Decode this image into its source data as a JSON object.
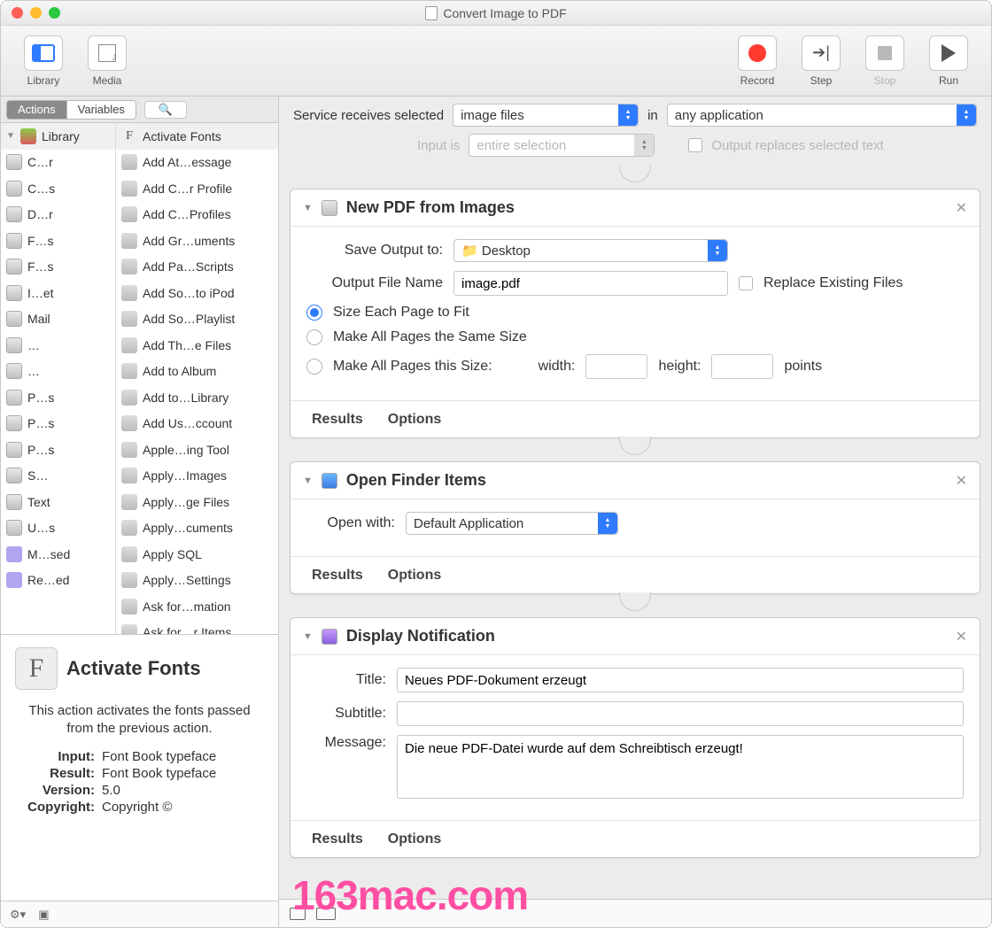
{
  "window": {
    "title": "Convert Image to PDF"
  },
  "toolbar": {
    "library": "Library",
    "media": "Media",
    "record": "Record",
    "step": "Step",
    "stop": "Stop",
    "run": "Run"
  },
  "tabs": {
    "actions": "Actions",
    "variables": "Variables"
  },
  "col1": {
    "header": "Library",
    "items": [
      "C…r",
      "C…s",
      "D…r",
      "F…s",
      "F…s",
      "I…et",
      "Mail",
      "…",
      "…",
      "P…s",
      "P…s",
      "P…s",
      "S…",
      "Text",
      "U…s",
      "M…sed",
      "Re…ed"
    ]
  },
  "col2": {
    "header": "Activate Fonts",
    "items": [
      "Add At…essage",
      "Add C…r Profile",
      "Add C…Profiles",
      "Add Gr…uments",
      "Add Pa…Scripts",
      "Add So…to iPod",
      "Add So…Playlist",
      "Add Th…e Files",
      "Add to Album",
      "Add to…Library",
      "Add Us…ccount",
      "Apple…ing Tool",
      "Apply…Images",
      "Apply…ge Files",
      "Apply…cuments",
      "Apply SQL",
      "Apply…Settings",
      "Ask for…mation",
      "Ask for…r Items"
    ]
  },
  "info": {
    "title": "Activate Fonts",
    "desc": "This action activates the fonts passed from the previous action.",
    "input_k": "Input:",
    "input_v": "Font Book typeface",
    "result_k": "Result:",
    "result_v": "Font Book typeface",
    "version_k": "Version:",
    "version_v": "5.0",
    "copyright_k": "Copyright:",
    "copyright_v": "Copyright ©"
  },
  "cfg": {
    "receives": "Service receives selected",
    "imagefiles": "image files",
    "in": "in",
    "anyapp": "any application",
    "inputis": "Input is",
    "entire": "entire selection",
    "replace": "Output replaces selected text"
  },
  "card1": {
    "title": "New PDF from Images",
    "save_lbl": "Save Output to:",
    "save_val": "Desktop",
    "fname_lbl": "Output File Name",
    "fname_val": "image.pdf",
    "replace": "Replace Existing Files",
    "r1": "Size Each Page to Fit",
    "r2": "Make All Pages the Same Size",
    "r3": "Make All Pages this Size:",
    "width": "width:",
    "height": "height:",
    "points": "points",
    "results": "Results",
    "options": "Options"
  },
  "card2": {
    "title": "Open Finder Items",
    "open_lbl": "Open with:",
    "open_val": "Default Application",
    "results": "Results",
    "options": "Options"
  },
  "card3": {
    "title": "Display Notification",
    "title_lbl": "Title:",
    "title_val": "Neues PDF-Dokument erzeugt",
    "sub_lbl": "Subtitle:",
    "sub_val": "",
    "msg_lbl": "Message:",
    "msg_val": "Die neue PDF-Datei wurde auf dem Schreibtisch erzeugt!",
    "results": "Results",
    "options": "Options"
  },
  "watermark": "163mac.com"
}
